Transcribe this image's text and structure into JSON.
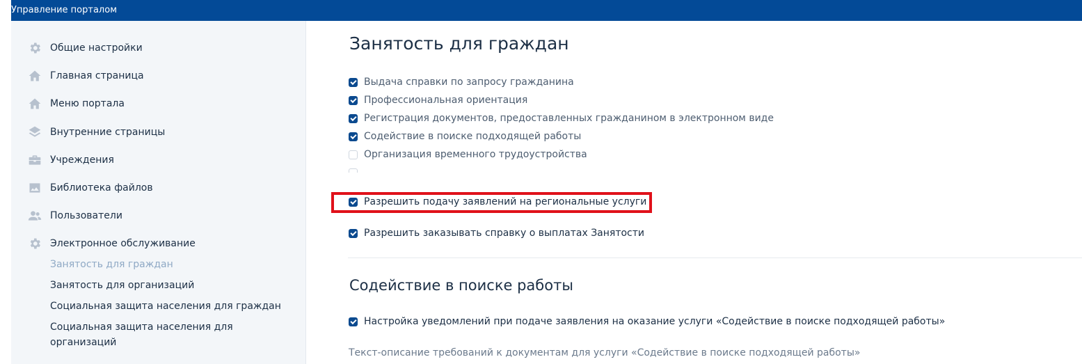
{
  "header": {
    "title": "Управление порталом"
  },
  "sidebar": {
    "items": [
      {
        "label": "Общие настройки",
        "icon": "gear-icon"
      },
      {
        "label": "Главная страница",
        "icon": "home-icon"
      },
      {
        "label": "Меню портала",
        "icon": "home-icon"
      },
      {
        "label": "Внутренние страницы",
        "icon": "layers-icon"
      },
      {
        "label": "Учреждения",
        "icon": "briefcase-icon"
      },
      {
        "label": "Библиотека файлов",
        "icon": "image-icon"
      },
      {
        "label": "Пользователи",
        "icon": "users-icon"
      },
      {
        "label": "Электронное обслуживание",
        "icon": "gear-icon"
      }
    ],
    "subitems": [
      {
        "label": "Занятость для граждан",
        "active": true
      },
      {
        "label": "Занятость для организаций",
        "active": false
      },
      {
        "label": "Социальная защита населения для граждан",
        "active": false
      },
      {
        "label": "Социальная защита населения для организаций",
        "active": false
      }
    ]
  },
  "main": {
    "section1": {
      "title": "Занятость для граждан",
      "services": [
        {
          "label": "Выдача справки по запросу гражданина",
          "checked": true
        },
        {
          "label": "Профессиональная ориентация",
          "checked": true
        },
        {
          "label": "Регистрация документов, предоставленных гражданином в электронном виде",
          "checked": true
        },
        {
          "label": "Содействие в поиске подходящей работы",
          "checked": true
        },
        {
          "label": "Организация временного трудоустройства",
          "checked": false
        }
      ],
      "allow_regional": {
        "label": "Разрешить подачу заявлений на региональные услуги",
        "checked": true
      },
      "allow_payments": {
        "label": "Разрешить заказывать справку о выплатах Занятости",
        "checked": true
      }
    },
    "section2": {
      "title": "Содействие в поиске работы",
      "notify": {
        "label": "Настройка уведомлений при подаче заявления на оказание услуги «Содействие в поиске подходящей работы»",
        "checked": true
      },
      "description": "Текст-описание требований к документам для услуги «Содействие в поиске подходящей работы»"
    }
  },
  "colors": {
    "header_bg": "#034a97",
    "checkbox": "#0b4a8f",
    "highlight": "#e0111a"
  }
}
